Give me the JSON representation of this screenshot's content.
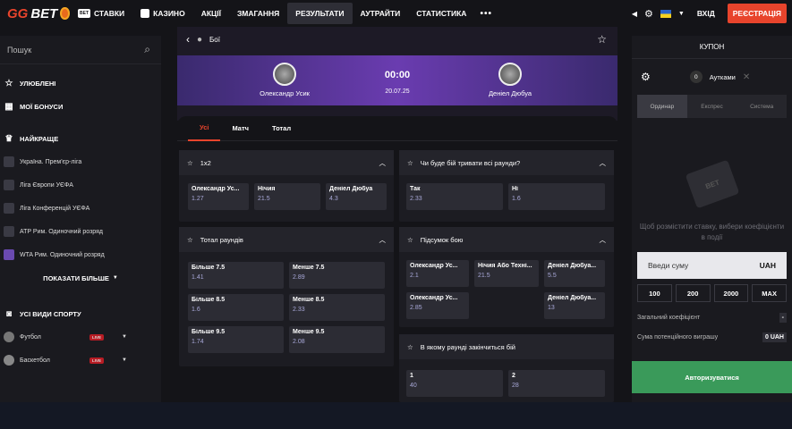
{
  "brand": {
    "gg": "GG",
    "bet": "BET"
  },
  "nav": [
    "СТАВКИ",
    "КАЗИНО",
    "АКЦІЇ",
    "ЗМАГАННЯ",
    "РЕЗУЛЬТАТИ",
    "АУТРАЙТИ",
    "СТАТИСТИКА"
  ],
  "nav_icons": {
    "bets": "BET",
    "casino": "cards-icon"
  },
  "header": {
    "login": "ВХІД",
    "register": "РЕЄСТРАЦІЯ"
  },
  "sidebar": {
    "search_placeholder": "Пошук",
    "favorites": "УЛЮБЛЕНІ",
    "bonuses": "МОЇ БОНУСИ",
    "best": "НАЙКРАЩЕ",
    "leagues": [
      "Україна. Прем'єр-ліга",
      "Ліга Європи УЄФА",
      "Ліга Конференцій УЄФА",
      "ATP Рим. Одиночний розряд",
      "WTA Рим. Одиночний розряд"
    ],
    "show_more": "ПОКАЗАТИ БІЛЬШЕ",
    "all_sports": "УСІ ВИДИ СПОРТУ",
    "sports": [
      {
        "name": "Футбол",
        "badge": "LIVE"
      },
      {
        "name": "Баскетбол",
        "badge": "LIVE"
      }
    ]
  },
  "event": {
    "breadcrumb": "Бої",
    "player1": "Олександр Усик",
    "player2": "Деніел Дюбуа",
    "time": "00:00",
    "date": "20.07.25"
  },
  "tabs": [
    "Усі",
    "Матч",
    "Тотал"
  ],
  "markets": {
    "m1x2": {
      "title": "1x2",
      "odds": [
        {
          "n": "Олександр Ус...",
          "v": "1.27"
        },
        {
          "n": "Нічия",
          "v": "21.5"
        },
        {
          "n": "Деніел Дюбуа",
          "v": "4.3"
        }
      ]
    },
    "allrounds": {
      "title": "Чи буде бій тривати всі раунди?",
      "odds": [
        {
          "n": "Так",
          "v": "2.33"
        },
        {
          "n": "Ні",
          "v": "1.6"
        }
      ]
    },
    "total": {
      "title": "Тотал раундів",
      "odds": [
        {
          "n": "Більше 7.5",
          "v": "1.41"
        },
        {
          "n": "Менше 7.5",
          "v": "2.89"
        },
        {
          "n": "Більше 8.5",
          "v": "1.6"
        },
        {
          "n": "Менше 8.5",
          "v": "2.33"
        },
        {
          "n": "Більше 9.5",
          "v": "1.74"
        },
        {
          "n": "Менше 9.5",
          "v": "2.08"
        }
      ]
    },
    "result": {
      "title": "Підсумок бою",
      "odds": [
        {
          "n": "Олександр Ус...",
          "v": "2.1"
        },
        {
          "n": "Нічия Або Техні...",
          "v": "21.5"
        },
        {
          "n": "Деніел Дюбуа...",
          "v": "5.5"
        },
        {
          "n": "Олександр Ус...",
          "v": "2.85"
        },
        {
          "n": "Деніел Дюбуа...",
          "v": "13"
        }
      ]
    },
    "round": {
      "title": "В якому раунді закінчиться бій",
      "odds": [
        {
          "n": "1",
          "v": "40"
        },
        {
          "n": "2",
          "v": "28"
        }
      ]
    }
  },
  "coupon": {
    "title": "КУПОН",
    "count": "0",
    "outcomes": "Аутками",
    "modes": [
      "Ординар",
      "Експрес",
      "Система"
    ],
    "ticket_text": "BET",
    "message": "Щоб розмістити ставку, вибери коефіцієнти в події",
    "amount_placeholder": "Введи суму",
    "currency": "UAH",
    "quick": [
      "100",
      "200",
      "2000",
      "MAX"
    ],
    "total_coef_label": "Загальний коефіцієнт",
    "total_coef": "-",
    "potential_label": "Сума потенційного виграшу",
    "potential": "0 UAH",
    "auth": "Авторизуватися"
  }
}
